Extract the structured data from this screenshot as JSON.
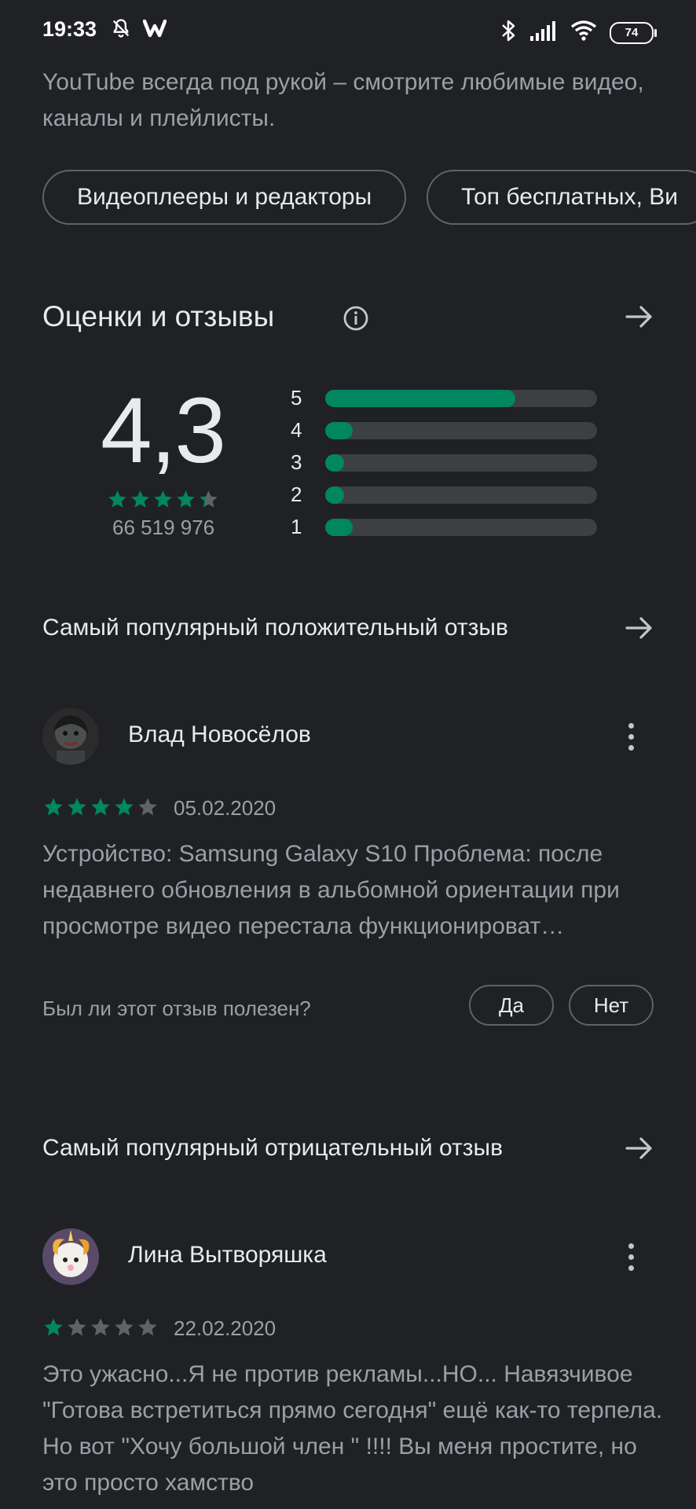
{
  "status_bar": {
    "time": "19:33",
    "battery": "74",
    "icons": [
      "mute-bell-icon",
      "w-app-icon",
      "bluetooth-icon",
      "signal-icon",
      "wifi-icon",
      "battery-icon"
    ]
  },
  "description": "YouTube всегда под рукой – смотрите любимые видео, каналы и плейлисты.",
  "chips": [
    "Видеоплееры и редакторы",
    "Топ бесплатных, Ви"
  ],
  "ratings": {
    "title": "Оценки и отзывы",
    "average": "4,3",
    "stars_value": 4.3,
    "total": "66 519 976",
    "histogram": [
      {
        "label": "5",
        "fraction": 0.7
      },
      {
        "label": "4",
        "fraction": 0.1
      },
      {
        "label": "3",
        "fraction": 0.07
      },
      {
        "label": "2",
        "fraction": 0.07
      },
      {
        "label": "1",
        "fraction": 0.1
      }
    ]
  },
  "positive": {
    "section_title": "Самый популярный положительный отзыв",
    "author": "Влад Новосёлов",
    "stars": 4,
    "date": "05.02.2020",
    "text": "Устройство: Samsung Galaxy S10 Проблема: после недавнего обновления в альбомной ориентации при просмотре видео перестала функционироват…",
    "helpful_question": "Был ли этот отзыв полезен?",
    "yes": "Да",
    "no": "Нет"
  },
  "negative": {
    "section_title": "Самый популярный отрицательный отзыв",
    "author": "Лина Вытворяшка",
    "stars": 1,
    "date": "22.02.2020",
    "text": "Это ужасно...Я не против рекламы...НО... Навязчивое \"Готова встретиться прямо сегодня\" ещё как-то терпела. Но вот \"Хочу большой член \" !!!! Вы меня простите, но это просто хамство"
  },
  "colors": {
    "background": "#202124",
    "accent_green": "#01875f",
    "star_empty": "#5f6368",
    "text_secondary": "#9aa0a6"
  }
}
